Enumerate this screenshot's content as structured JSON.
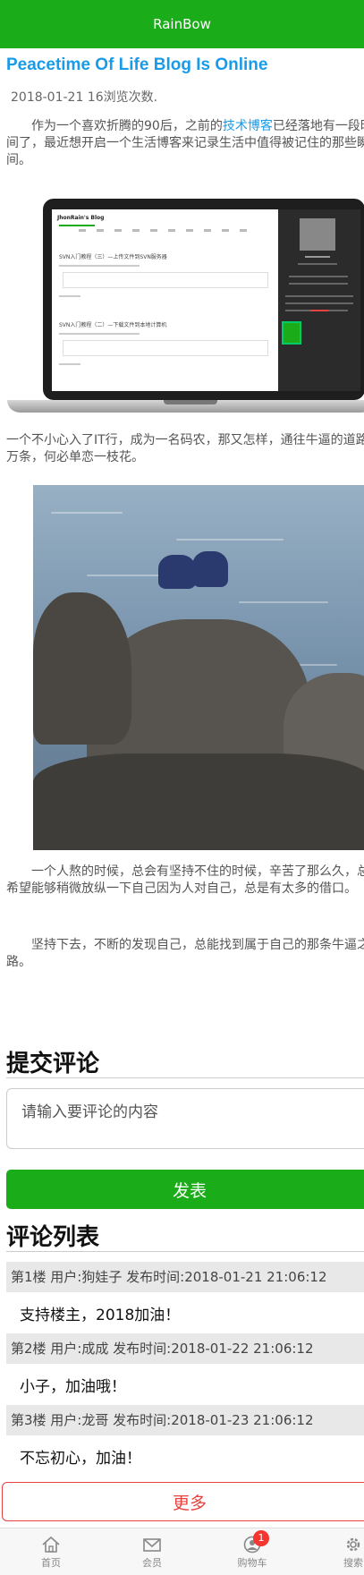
{
  "app": {
    "title": "RainBow"
  },
  "article": {
    "title": "Peacetime Of Life Blog Is Online",
    "meta": "2018-01-21 16浏览次数.",
    "para1_before": "　　作为一个喜欢折腾的90后，之前的",
    "para1_link": "技术博客",
    "para1_after": "已经落地有一段时间了，最近想开启一个生活博客来记录生活中值得被记住的那些瞬间。",
    "para2": "一个不小心入了IT行，成为一名码农，那又怎样，通往牛逼的道路千万条，何必单恋一枝花。",
    "para3": "　　一个人熬的时候，总会有坚持不住的时候，辛苦了那么久，总是希望能够稍微放纵一下自己因为人对自己，总是有太多的借口。",
    "para4": "　　坚持下去，不断的发现自己，总能找到属于自己的那条牛逼之路。",
    "laptop_screen": {
      "blog_name": "JhonRain's Blog",
      "post1_title": "SVN入门教程（三）—上传文件到SVN服务器",
      "post2_title": "SVN入门教程（二）—下载文件到本地计算机"
    }
  },
  "comment_form": {
    "title": "提交评论",
    "placeholder": "请输入要评论的内容",
    "submit_label": "发表"
  },
  "comments": {
    "title": "评论列表",
    "items": [
      {
        "header": "第1楼 用户:狗娃子 发布时间:2018-01-21 21:06:12",
        "body": "支持楼主，2018加油！"
      },
      {
        "header": "第2楼 用户:成成 发布时间:2018-01-22 21:06:12",
        "body": "小子，加油哦！"
      },
      {
        "header": "第3楼 用户:龙哥 发布时间:2018-01-23 21:06:12",
        "body": "不忘初心，加油！"
      }
    ],
    "more_label": "更多"
  },
  "tabbar": {
    "items": [
      {
        "label": "首页",
        "icon": "home-icon"
      },
      {
        "label": "会员",
        "icon": "mail-icon"
      },
      {
        "label": "购物车",
        "icon": "cart-icon",
        "badge": "1"
      },
      {
        "label": "搜索",
        "icon": "gear-icon"
      }
    ]
  },
  "colors": {
    "brand": "#1aad19",
    "link": "#1a9be8",
    "danger": "#e64340",
    "badge": "#f43530"
  }
}
